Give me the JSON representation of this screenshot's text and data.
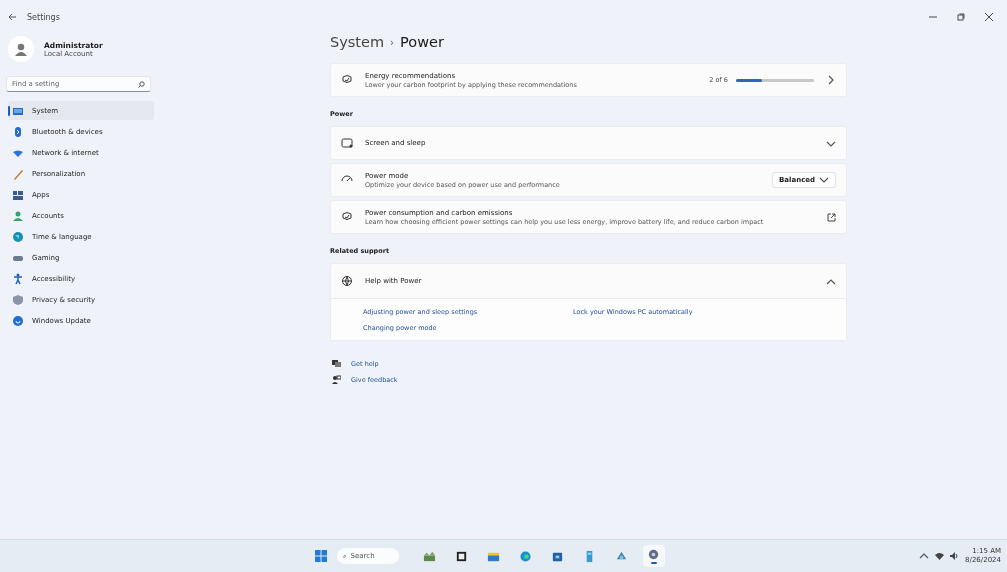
{
  "window": {
    "title": "Settings"
  },
  "user": {
    "name": "Administrator",
    "account": "Local Account"
  },
  "search": {
    "placeholder": "Find a setting"
  },
  "sidebar": {
    "items": [
      {
        "label": "System",
        "selected": true
      },
      {
        "label": "Bluetooth & devices",
        "selected": false
      },
      {
        "label": "Network & internet",
        "selected": false
      },
      {
        "label": "Personalization",
        "selected": false
      },
      {
        "label": "Apps",
        "selected": false
      },
      {
        "label": "Accounts",
        "selected": false
      },
      {
        "label": "Time & language",
        "selected": false
      },
      {
        "label": "Gaming",
        "selected": false
      },
      {
        "label": "Accessibility",
        "selected": false
      },
      {
        "label": "Privacy & security",
        "selected": false
      },
      {
        "label": "Windows Update",
        "selected": false
      }
    ]
  },
  "breadcrumb": {
    "parent": "System",
    "separator": "›",
    "current": "Power"
  },
  "top_cards": [
    {
      "kind": "progress",
      "title": "Energy recommendations",
      "description": "Lower your carbon footprint by applying these recommendations",
      "reading": "2 of 6",
      "level": 0.33
    }
  ],
  "sections": [
    {
      "heading": "Power",
      "cards": [
        {
          "kind": "expander",
          "title": "Screen and sleep",
          "expanded": false
        },
        {
          "kind": "dropdown",
          "title": "Power mode",
          "description": "Optimize your device based on power use and performance",
          "value": "Balanced"
        },
        {
          "kind": "external",
          "title": "Power consumption and carbon emissions",
          "description": "Learn how choosing efficient power settings can help you use less energy, improve battery life, and reduce carbon impact"
        }
      ]
    },
    {
      "heading": "Related support",
      "cards": [
        {
          "kind": "help",
          "title": "Help with Power",
          "expanded": true,
          "links": [
            "Adjusting power and sleep settings",
            "Lock your Windows PC automatically",
            "Changing power mode"
          ]
        }
      ]
    }
  ],
  "footer_links": [
    "Get help",
    "Give feedback"
  ],
  "taskbar": {
    "search_placeholder": "Search",
    "apps": [
      {
        "selected": false
      },
      {
        "selected": false
      },
      {
        "selected": false
      },
      {
        "selected": false
      },
      {
        "selected": false
      },
      {
        "selected": false
      },
      {
        "selected": false
      },
      {
        "selected": true
      }
    ],
    "time": "1:15 AM",
    "date": "8/26/2024"
  }
}
